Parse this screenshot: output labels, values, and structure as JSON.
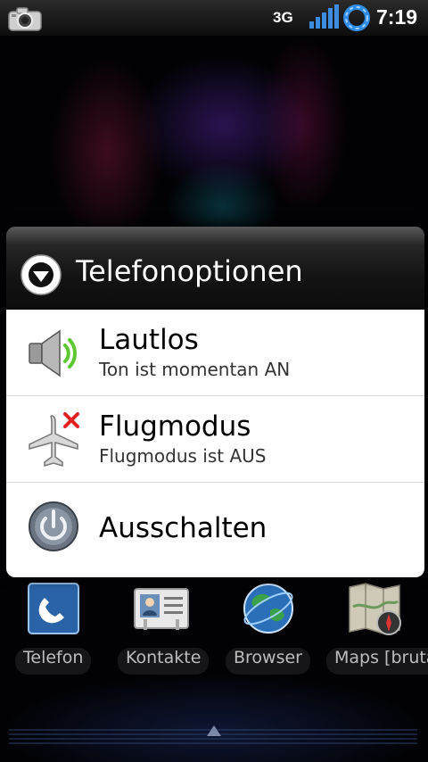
{
  "status_bar": {
    "network_type": "3G",
    "time": "7:19",
    "icons": [
      "camera-icon",
      "signal-icon",
      "sync-icon"
    ]
  },
  "dialog": {
    "title": "Telefonoptionen",
    "header_icon": "chevron-down-circle-icon",
    "options": [
      {
        "icon": "speaker-icon",
        "title": "Lautlos",
        "subtitle": "Ton ist momentan AN"
      },
      {
        "icon": "airplane-icon",
        "title": "Flugmodus",
        "subtitle": "Flugmodus ist AUS"
      },
      {
        "icon": "power-icon",
        "title": "Ausschalten"
      }
    ]
  },
  "dock": {
    "items": [
      {
        "label": "Telefon",
        "icon": "phone-icon"
      },
      {
        "label": "Kontakte",
        "icon": "contacts-icon"
      },
      {
        "label": "Browser",
        "icon": "globe-icon"
      },
      {
        "label": "Maps [bruta",
        "icon": "maps-icon"
      }
    ]
  },
  "colors": {
    "dialog_body": "#ffffff",
    "dialog_header": "#141414",
    "accent_red": "#e02020",
    "speaker_green": "#5cc830"
  }
}
